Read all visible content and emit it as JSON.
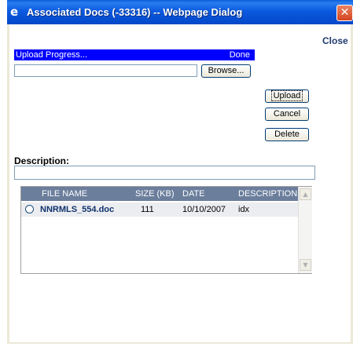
{
  "window": {
    "title": "Associated Docs (-33316) -- Webpage Dialog",
    "close_glyph": "✕"
  },
  "header": {
    "close_label": "Close"
  },
  "upload": {
    "progress_label": "Upload Progress...",
    "progress_status": "Done",
    "file_value": "",
    "browse_label": "Browse...",
    "upload_label": "Upload",
    "cancel_label": "Cancel",
    "delete_label": "Delete"
  },
  "description": {
    "label": "Description:",
    "value": ""
  },
  "files": {
    "columns": [
      "FILE NAME",
      "SIZE (KB)",
      "DATE",
      "DESCRIPTION"
    ],
    "rows": [
      {
        "name": "NNRMLS_554.doc",
        "size": "111",
        "date": "10/10/2007",
        "description": "idx"
      }
    ]
  },
  "icons": {
    "window_icon": "ie-icon",
    "scroll_up": "▲",
    "scroll_down": "▼"
  },
  "colors": {
    "titlebar": "#0b5ae0",
    "progress": "#0000ff",
    "grid_header": "#6b7e9c",
    "close_button": "#d44422"
  }
}
